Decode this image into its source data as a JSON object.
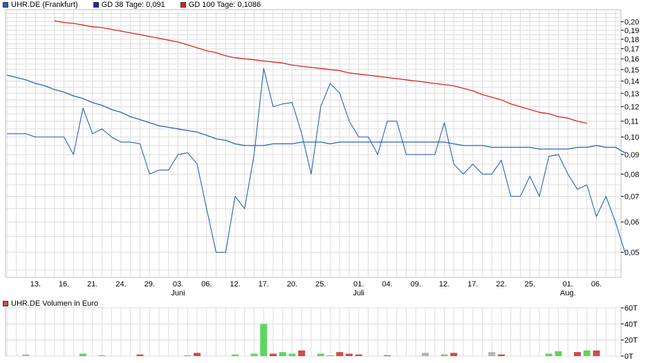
{
  "legend": {
    "main_series": "UHR.DE (Frankfurt)",
    "gd38": "GD 38 Tage: 0,091",
    "gd100": "GD 100 Tage: 0,1086",
    "volume": "UHR.DE Volumen in Euro"
  },
  "colors": {
    "price": "#2a5fb8",
    "gd38": "#1e22c8",
    "gd100": "#e02020",
    "vol_up": "#5ed65e",
    "vol_down": "#d24a4a",
    "vol_neutral": "#b4b4b4",
    "grid": "#dcdcdc"
  },
  "chart_data": [
    {
      "type": "line",
      "yscale": "log",
      "ylim": [
        0.043,
        0.215
      ],
      "yticks": [
        0.2,
        0.19,
        0.18,
        0.17,
        0.16,
        0.15,
        0.14,
        0.13,
        0.12,
        0.11,
        0.1,
        0.09,
        0.08,
        0.07,
        0.06,
        0.05
      ],
      "ytick_labels": [
        "0,20",
        "0,19",
        "0,18",
        "0,17",
        "0,16",
        "0,15",
        "0,14",
        "0,13",
        "0,12",
        "0,11",
        "0,10",
        "0,09",
        "0,08",
        "0,07",
        "0,06",
        "0,05"
      ],
      "x_tick_labels": [
        "13.",
        "16.",
        "21.",
        "24.",
        "29.",
        "03.",
        "06.",
        "12.",
        "17.",
        "20.",
        "25.",
        "01.",
        "04.",
        "09.",
        "12.",
        "17.",
        "22.",
        "25.",
        "01.",
        "06."
      ],
      "x_tick_index": [
        3,
        6,
        9,
        12,
        15,
        18,
        21,
        24,
        27,
        30,
        33,
        37,
        40,
        43,
        46,
        49,
        52,
        55,
        59,
        62
      ],
      "month_labels": [
        {
          "label": "Juni",
          "index": 18
        },
        {
          "label": "Juli",
          "index": 37
        },
        {
          "label": "Aug.",
          "index": 59
        }
      ],
      "n_points": 65,
      "series": [
        {
          "name": "UHR.DE (Frankfurt)",
          "values": [
            0.102,
            0.102,
            0.102,
            0.1,
            0.1,
            0.1,
            0.1,
            0.09,
            0.119,
            0.102,
            0.105,
            0.1,
            0.097,
            0.097,
            0.096,
            0.08,
            0.082,
            0.082,
            0.09,
            0.091,
            0.085,
            0.065,
            0.05,
            0.05,
            0.07,
            0.065,
            0.09,
            0.151,
            0.12,
            0.122,
            0.123,
            0.102,
            0.08,
            0.12,
            0.138,
            0.13,
            0.11,
            0.1,
            0.1,
            0.09,
            0.11,
            0.11,
            0.09,
            0.09,
            0.09,
            0.09,
            0.109,
            0.085,
            0.08,
            0.085,
            0.08,
            0.08,
            0.087,
            0.07,
            0.07,
            0.079,
            0.07,
            0.089,
            0.09,
            0.08,
            0.073,
            0.075,
            0.062,
            0.07,
            0.06,
            0.05
          ]
        },
        {
          "name": "GD 38 Tage: 0,091",
          "values": [
            0.145,
            0.143,
            0.141,
            0.138,
            0.136,
            0.133,
            0.131,
            0.128,
            0.126,
            0.123,
            0.121,
            0.118,
            0.116,
            0.113,
            0.111,
            0.109,
            0.107,
            0.106,
            0.105,
            0.104,
            0.103,
            0.101,
            0.099,
            0.098,
            0.096,
            0.095,
            0.095,
            0.095,
            0.096,
            0.096,
            0.096,
            0.097,
            0.097,
            0.097,
            0.096,
            0.097,
            0.097,
            0.097,
            0.097,
            0.097,
            0.097,
            0.097,
            0.097,
            0.097,
            0.097,
            0.097,
            0.097,
            0.096,
            0.095,
            0.095,
            0.095,
            0.094,
            0.094,
            0.094,
            0.094,
            0.094,
            0.093,
            0.093,
            0.093,
            0.093,
            0.094,
            0.094,
            0.095,
            0.094,
            0.094,
            0.091
          ]
        },
        {
          "name": "GD 100 Tage: 0,1086",
          "start_index": 5,
          "values": [
            0.201,
            0.199,
            0.198,
            0.196,
            0.194,
            0.193,
            0.191,
            0.189,
            0.187,
            0.185,
            0.183,
            0.181,
            0.179,
            0.177,
            0.174,
            0.171,
            0.168,
            0.166,
            0.163,
            0.161,
            0.16,
            0.159,
            0.158,
            0.157,
            0.156,
            0.154,
            0.153,
            0.152,
            0.151,
            0.15,
            0.149,
            0.147,
            0.146,
            0.145,
            0.144,
            0.143,
            0.142,
            0.141,
            0.14,
            0.139,
            0.138,
            0.137,
            0.136,
            0.134,
            0.132,
            0.129,
            0.127,
            0.125,
            0.122,
            0.12,
            0.118,
            0.116,
            0.115,
            0.113,
            0.112,
            0.11,
            0.1086
          ]
        }
      ]
    },
    {
      "type": "bar",
      "title": "UHR.DE Volumen in Euro",
      "ylim": [
        0,
        60
      ],
      "yticks": [
        0,
        20,
        40,
        60
      ],
      "ytick_labels": [
        "0T",
        "20T",
        "40T",
        "60T"
      ],
      "n_points": 65,
      "bars": [
        {
          "index": 2,
          "value": 2.0,
          "dir": "neutral"
        },
        {
          "index": 8,
          "value": 3.0,
          "dir": "up"
        },
        {
          "index": 10,
          "value": 1.0,
          "dir": "up"
        },
        {
          "index": 14,
          "value": 2.0,
          "dir": "down"
        },
        {
          "index": 19,
          "value": 1.0,
          "dir": "up"
        },
        {
          "index": 20,
          "value": 4.0,
          "dir": "down"
        },
        {
          "index": 24,
          "value": 2.0,
          "dir": "up"
        },
        {
          "index": 26,
          "value": 3.0,
          "dir": "up"
        },
        {
          "index": 27,
          "value": 40.0,
          "dir": "up"
        },
        {
          "index": 28,
          "value": 3.0,
          "dir": "down"
        },
        {
          "index": 29,
          "value": 5.0,
          "dir": "up"
        },
        {
          "index": 30,
          "value": 3.0,
          "dir": "up"
        },
        {
          "index": 31,
          "value": 7.0,
          "dir": "down"
        },
        {
          "index": 33,
          "value": 3.0,
          "dir": "up"
        },
        {
          "index": 34,
          "value": 1.0,
          "dir": "up"
        },
        {
          "index": 35,
          "value": 5.0,
          "dir": "down"
        },
        {
          "index": 36,
          "value": 3.0,
          "dir": "down"
        },
        {
          "index": 37,
          "value": 2.0,
          "dir": "down"
        },
        {
          "index": 40,
          "value": 1.0,
          "dir": "down"
        },
        {
          "index": 44,
          "value": 4.0,
          "dir": "neutral"
        },
        {
          "index": 46,
          "value": 2.0,
          "dir": "up"
        },
        {
          "index": 47,
          "value": 4.0,
          "dir": "down"
        },
        {
          "index": 51,
          "value": 5.0,
          "dir": "neutral"
        },
        {
          "index": 52,
          "value": 2.0,
          "dir": "down"
        },
        {
          "index": 57,
          "value": 3.0,
          "dir": "up"
        },
        {
          "index": 58,
          "value": 6.0,
          "dir": "up"
        },
        {
          "index": 60,
          "value": 5.0,
          "dir": "down"
        },
        {
          "index": 61,
          "value": 7.0,
          "dir": "up"
        },
        {
          "index": 62,
          "value": 7.0,
          "dir": "down"
        }
      ]
    }
  ]
}
